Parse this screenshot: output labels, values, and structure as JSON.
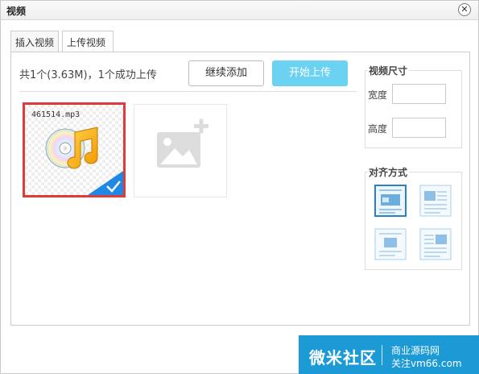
{
  "dialog": {
    "title": "视频",
    "close_glyph": "✕"
  },
  "tabs": [
    {
      "label": "插入视频",
      "active": false
    },
    {
      "label": "上传视频",
      "active": true
    }
  ],
  "upload": {
    "summary": "共1个(3.63M)，1个成功上传",
    "continue_label": "继续添加",
    "start_label": "开始上传",
    "accent_color": "#6bd2f2"
  },
  "files": [
    {
      "name": "461514.mp3",
      "icon": "music-cd-icon",
      "status": "success",
      "selected": true
    }
  ],
  "add_tile": {
    "icon": "add-image-icon"
  },
  "video_size": {
    "legend": "视频尺寸",
    "width_label": "宽度",
    "height_label": "高度",
    "width_value": "",
    "height_value": ""
  },
  "alignment": {
    "legend": "对齐方式",
    "options": [
      {
        "icon": "align-none-icon",
        "selected": true
      },
      {
        "icon": "align-left-icon",
        "selected": false
      },
      {
        "icon": "align-center-icon",
        "selected": false
      },
      {
        "icon": "align-right-icon",
        "selected": false
      }
    ]
  },
  "watermark": {
    "main": "微米社区",
    "line1": "商业源码网",
    "line2": "关注vm66.com",
    "color": "#1b9ad6"
  }
}
